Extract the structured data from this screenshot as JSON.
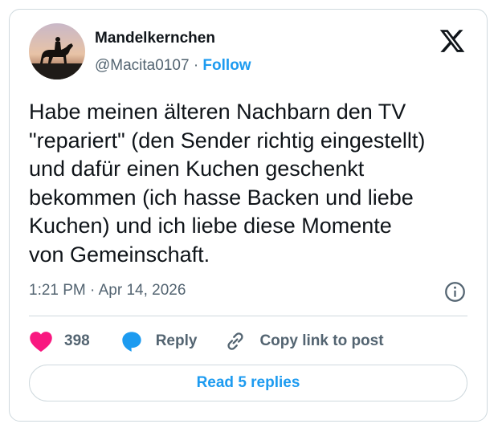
{
  "author": {
    "name": "Mandelkernchen",
    "handle": "@Macita0107",
    "separator": "·",
    "follow_label": "Follow"
  },
  "tweet": {
    "text": "Habe meinen älteren Nachbarn den TV\n\"repariert\" (den Sender richtig eingestellt)\nund dafür einen Kuchen geschenkt\nbekommen (ich hasse Backen und liebe\nKuchen) und ich liebe diese Momente\nvon Gemeinschaft.",
    "timestamp": "1:21 PM · Apr 14, 2026"
  },
  "actions": {
    "like_count": "398",
    "reply_label": "Reply",
    "copy_link_label": "Copy link to post"
  },
  "read_replies_label": "Read 5 replies",
  "icons": {
    "brand": "x-logo-icon",
    "info": "info-icon",
    "like": "heart-icon",
    "reply": "speech-bubble-icon",
    "copy": "link-icon"
  },
  "colors": {
    "accent": "#1d9bf0",
    "like": "#f91880",
    "text": "#0f1419",
    "muted": "#536471",
    "border": "#cfd9de"
  }
}
